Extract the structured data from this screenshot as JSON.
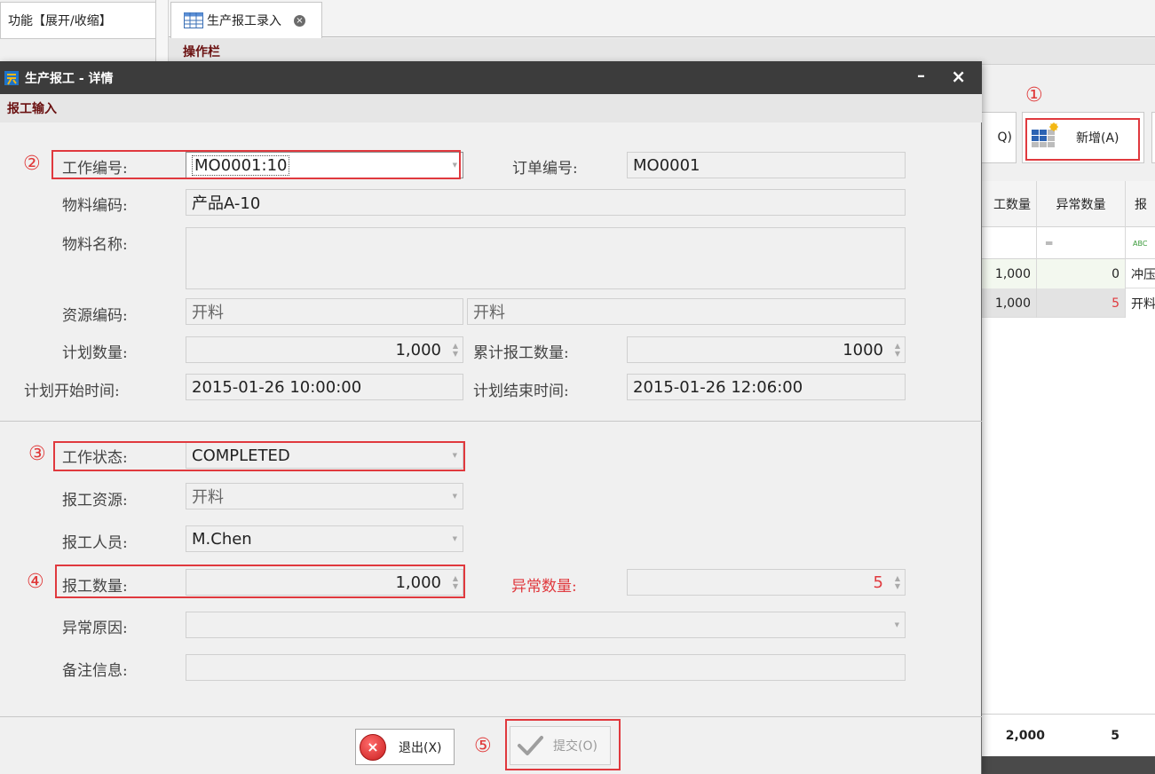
{
  "left_panel": {
    "header": "功能【展开/收缩】"
  },
  "tabs": [
    {
      "label": "生产报工录入",
      "close": "⊗"
    }
  ],
  "opbar": {
    "title": "操作栏"
  },
  "toolbar": {
    "partial_label": "Q)",
    "add_label": "新增(A)"
  },
  "grid": {
    "columns": [
      "工数量",
      "异常数量",
      "报"
    ],
    "filter": [
      "",
      "═",
      "ABC"
    ],
    "rows": [
      {
        "qty": "1,000",
        "abn": "0",
        "res": "冲压"
      },
      {
        "qty": "1,000",
        "abn": "5",
        "res": "开料"
      }
    ],
    "footer": {
      "qty": "2,000",
      "abn": "5"
    }
  },
  "annotations": {
    "a1": "①",
    "a2": "②",
    "a3": "③",
    "a4": "④",
    "a5": "⑤"
  },
  "dialog": {
    "title": "生产报工 - 详情",
    "section": "报工输入",
    "min": "–",
    "close": "×",
    "fields": {
      "work_no": {
        "label": "工作编号:",
        "value": "MO0001:10"
      },
      "order_no": {
        "label": "订单编号:",
        "value": "MO0001"
      },
      "material_code": {
        "label": "物料编码:",
        "value": "产品A-10"
      },
      "material_name": {
        "label": "物料名称:",
        "value": ""
      },
      "resource_code": {
        "label": "资源编码:",
        "value1": "开料",
        "value2": "开料"
      },
      "plan_qty": {
        "label": "计划数量:",
        "value": "1,000"
      },
      "cum_qty": {
        "label": "累计报工数量:",
        "value": "1000"
      },
      "plan_start": {
        "label": "计划开始时间:",
        "value": "2015-01-26 10:00:00"
      },
      "plan_end": {
        "label": "计划结束时间:",
        "value": "2015-01-26 12:06:00"
      },
      "work_status": {
        "label": "工作状态:",
        "value": "COMPLETED"
      },
      "report_resource": {
        "label": "报工资源:",
        "value": "开料"
      },
      "report_person": {
        "label": "报工人员:",
        "value": "M.Chen"
      },
      "report_qty": {
        "label": "报工数量:",
        "value": "1,000"
      },
      "abnormal_qty": {
        "label": "异常数量:",
        "value": "5"
      },
      "abnormal_reason": {
        "label": "异常原因:",
        "value": ""
      },
      "remark": {
        "label": "备注信息:",
        "value": ""
      }
    },
    "buttons": {
      "exit": "退出(X)",
      "submit": "提交(O)"
    }
  },
  "colors": {
    "annotation_red": "#e0393e",
    "title_bar": "#3c3c3c",
    "section_text": "#6a1010"
  }
}
